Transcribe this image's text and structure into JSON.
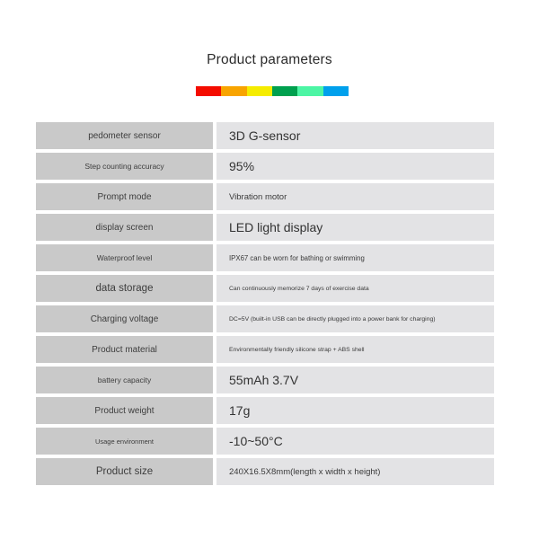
{
  "header": {
    "title": "Product parameters"
  },
  "colorbar": {
    "name": "decorative-color-bar",
    "segments": [
      {
        "name": "red",
        "hex": "#f40c00"
      },
      {
        "name": "orange",
        "hex": "#f8a400"
      },
      {
        "name": "yellow",
        "hex": "#f5ec00"
      },
      {
        "name": "dark-green",
        "hex": "#00a04e"
      },
      {
        "name": "mint-green",
        "hex": "#4cf5a4"
      },
      {
        "name": "blue",
        "hex": "#00a0ec"
      }
    ]
  },
  "table": {
    "rows": [
      {
        "label": "pedometer sensor",
        "label_size": "md",
        "value": "3D G-sensor",
        "value_size": "lg"
      },
      {
        "label": "Step counting accuracy",
        "label_size": "sm",
        "value": "95%",
        "value_size": "lg"
      },
      {
        "label": "Prompt mode",
        "label_size": "md",
        "value": "Vibration motor",
        "value_size": "md"
      },
      {
        "label": "display screen",
        "label_size": "md",
        "value": "LED light display",
        "value_size": "lg"
      },
      {
        "label": "Waterproof level",
        "label_size": "sm",
        "value": "IPX67 can be worn for bathing or swimming",
        "value_size": "sm"
      },
      {
        "label": "data storage",
        "label_size": "lg",
        "value": "Can continuously memorize 7 days of exercise data",
        "value_size": "xs"
      },
      {
        "label": "Charging voltage",
        "label_size": "md",
        "value": "DC=5V (built-in USB can be directly plugged into a power bank for charging)",
        "value_size": "xs"
      },
      {
        "label": "Product material",
        "label_size": "md",
        "value": "Environmentally friendly silicone strap + ABS shell",
        "value_size": "xs"
      },
      {
        "label": "battery capacity",
        "label_size": "sm",
        "value": "55mAh 3.7V",
        "value_size": "lg"
      },
      {
        "label": "Product weight",
        "label_size": "md",
        "value": "17g",
        "value_size": "lg"
      },
      {
        "label": "Usage environment",
        "label_size": "xs",
        "value": "-10~50°C",
        "value_size": "lg"
      },
      {
        "label": "Product size",
        "label_size": "lg",
        "value": "240X16.5X8mm(length x width x height)",
        "value_size": "md"
      }
    ]
  },
  "colors": {
    "label_cell_bg": "#c9c9c9",
    "value_cell_bg": "#e3e3e5",
    "page_bg": "#ffffff",
    "text": "#3a3a3a"
  }
}
